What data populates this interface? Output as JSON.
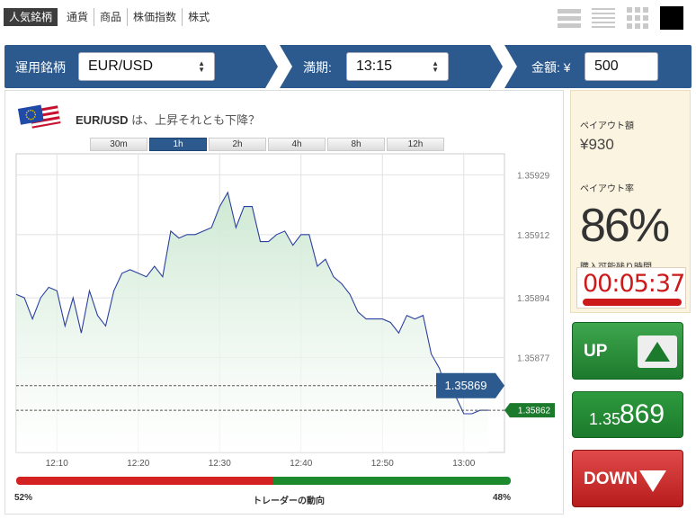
{
  "nav": {
    "tabs": [
      "人気銘柄",
      "通貨",
      "商品",
      "株価指数",
      "株式"
    ],
    "active_tab": 0
  },
  "toolbar": {
    "asset_label": "運用銘柄",
    "asset_value": "EUR/USD",
    "expiry_label": "満期:",
    "expiry_value": "13:15",
    "amount_label": "金額: ¥",
    "amount_value": "500"
  },
  "question": {
    "pair": "EUR/USD",
    "text": "は、上昇それとも下降？"
  },
  "timeframes": {
    "buttons": [
      "30m",
      "1h",
      "2h",
      "4h",
      "8h",
      "12h"
    ],
    "selected": "1h"
  },
  "chart_data": {
    "type": "area",
    "x_ticks": [
      "12:10",
      "12:20",
      "12:30",
      "12:40",
      "12:50",
      "13:00"
    ],
    "y_ticks": [
      "1.35929",
      "1.35912",
      "1.35894",
      "1.35877"
    ],
    "ylim": [
      1.3585,
      1.35935
    ],
    "xlim": [
      "12:05",
      "13:05"
    ],
    "current_price_label": "1.35869",
    "last_price_label": "1.35862",
    "series": [
      {
        "values": [
          [
            "12:05",
            1.35895
          ],
          [
            "12:06",
            1.35894
          ],
          [
            "12:07",
            1.35888
          ],
          [
            "12:08",
            1.35894
          ],
          [
            "12:09",
            1.35897
          ],
          [
            "12:10",
            1.35896
          ],
          [
            "12:11",
            1.35886
          ],
          [
            "12:12",
            1.35894
          ],
          [
            "12:13",
            1.35884
          ],
          [
            "12:14",
            1.35896
          ],
          [
            "12:15",
            1.35889
          ],
          [
            "12:16",
            1.35886
          ],
          [
            "12:17",
            1.35896
          ],
          [
            "12:18",
            1.35901
          ],
          [
            "12:19",
            1.35902
          ],
          [
            "12:20",
            1.35901
          ],
          [
            "12:21",
            1.359
          ],
          [
            "12:22",
            1.35903
          ],
          [
            "12:23",
            1.359
          ],
          [
            "12:24",
            1.35913
          ],
          [
            "12:25",
            1.35911
          ],
          [
            "12:26",
            1.35912
          ],
          [
            "12:27",
            1.35912
          ],
          [
            "12:28",
            1.35913
          ],
          [
            "12:29",
            1.35914
          ],
          [
            "12:30",
            1.3592
          ],
          [
            "12:31",
            1.35924
          ],
          [
            "12:32",
            1.35914
          ],
          [
            "12:33",
            1.3592
          ],
          [
            "12:34",
            1.3592
          ],
          [
            "12:35",
            1.3591
          ],
          [
            "12:36",
            1.3591
          ],
          [
            "12:37",
            1.35912
          ],
          [
            "12:38",
            1.35913
          ],
          [
            "12:39",
            1.35909
          ],
          [
            "12:40",
            1.35912
          ],
          [
            "12:41",
            1.35912
          ],
          [
            "12:42",
            1.35903
          ],
          [
            "12:43",
            1.35905
          ],
          [
            "12:44",
            1.359
          ],
          [
            "12:45",
            1.35898
          ],
          [
            "12:46",
            1.35895
          ],
          [
            "12:47",
            1.3589
          ],
          [
            "12:48",
            1.35888
          ],
          [
            "12:49",
            1.35888
          ],
          [
            "12:50",
            1.35888
          ],
          [
            "12:51",
            1.35887
          ],
          [
            "12:52",
            1.35884
          ],
          [
            "12:53",
            1.35889
          ],
          [
            "12:54",
            1.35888
          ],
          [
            "12:55",
            1.35889
          ],
          [
            "12:56",
            1.35878
          ],
          [
            "12:57",
            1.35874
          ],
          [
            "12:58",
            1.35867
          ],
          [
            "12:59",
            1.35866
          ],
          [
            "13:00",
            1.35861
          ],
          [
            "13:01",
            1.35861
          ],
          [
            "13:02",
            1.35862
          ],
          [
            "13:03",
            1.35862
          ]
        ]
      }
    ],
    "grid": true,
    "line_color": "#2a3fa0",
    "fill_color": "#cde8d2"
  },
  "sentiment": {
    "left_pct": "52%",
    "right_pct": "48%",
    "left_value": 52,
    "label": "トレーダーの動向",
    "left_color": "#d42121",
    "right_color": "#1d8a2e"
  },
  "side": {
    "payout_label": "ペイアウト額",
    "payout_value": "¥930",
    "rate_label": "ペイアウト率",
    "rate_value": "86%",
    "time_label": "購入可能残り時間",
    "time_value": "00:05:37"
  },
  "buttons": {
    "up_label": "UP",
    "price_small": "1.35",
    "price_big": "869",
    "down_label": "DOWN"
  },
  "colors": {
    "nav_blue": "#2c5a8f",
    "up_green": "#1c7a2c",
    "down_red": "#b81c1c",
    "timer_red": "#cc1a1a",
    "panel_cream": "#fbf4e1"
  }
}
